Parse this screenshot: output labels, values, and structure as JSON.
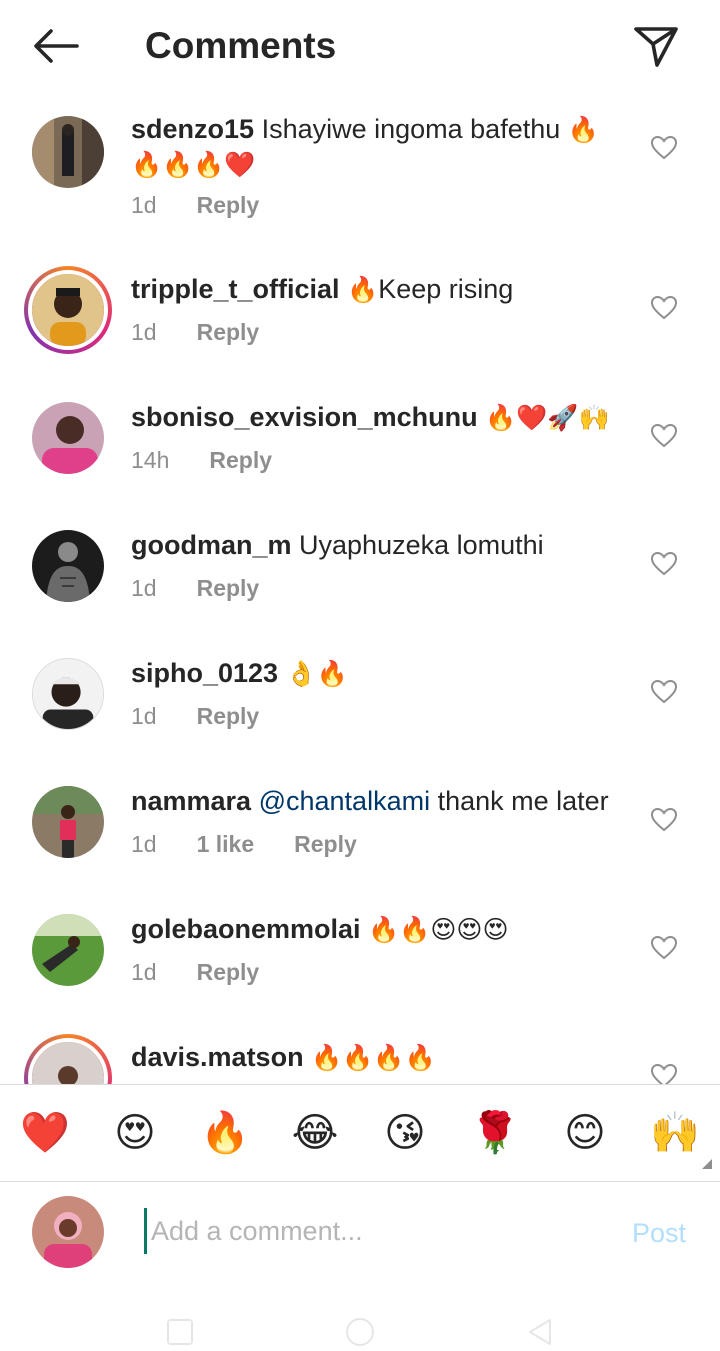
{
  "header": {
    "title": "Comments",
    "back_icon": "arrow-left-icon",
    "share_icon": "paper-plane-icon"
  },
  "comments": [
    {
      "username": "sdenzo15",
      "text": "Ishayiwe ingoma bafethu",
      "emoji": "🔥",
      "emoji_line2": "🔥🔥🔥❤️",
      "time": "1d",
      "reply": "Reply"
    },
    {
      "username": "tripple_t_official",
      "emoji": "🔥",
      "text": "Keep rising",
      "time": "1d",
      "reply": "Reply"
    },
    {
      "username": "sboniso_exvision_mchunu",
      "emoji": "🔥❤️🚀🙌",
      "time": "14h",
      "reply": "Reply"
    },
    {
      "username": "goodman_m",
      "text": "Uyaphuzeka lomuthi",
      "time": "1d",
      "reply": "Reply"
    },
    {
      "username": "sipho_0123",
      "emoji": "👌🔥",
      "time": "1d",
      "reply": "Reply"
    },
    {
      "username": "nammara",
      "mention": "@chantalkami",
      "text": "thank me later",
      "time": "1d",
      "likes": "1 like",
      "reply": "Reply"
    },
    {
      "username": "golebaonemmolai",
      "emoji": "🔥🔥😍😍😍",
      "time": "1d",
      "reply": "Reply"
    },
    {
      "username": "davis.matson",
      "emoji": "🔥🔥🔥🔥"
    }
  ],
  "quick_emojis": [
    "❤️",
    "😍",
    "🔥",
    "😂",
    "😘",
    "🌹",
    "😊",
    "🙌"
  ],
  "composer": {
    "placeholder": "Add a comment...",
    "post_label": "Post"
  },
  "colors": {
    "text": "#262626",
    "secondary": "#8e8e8e",
    "mention": "#00376b",
    "post_disabled": "#b2dffc",
    "border": "#dbdbdb"
  }
}
